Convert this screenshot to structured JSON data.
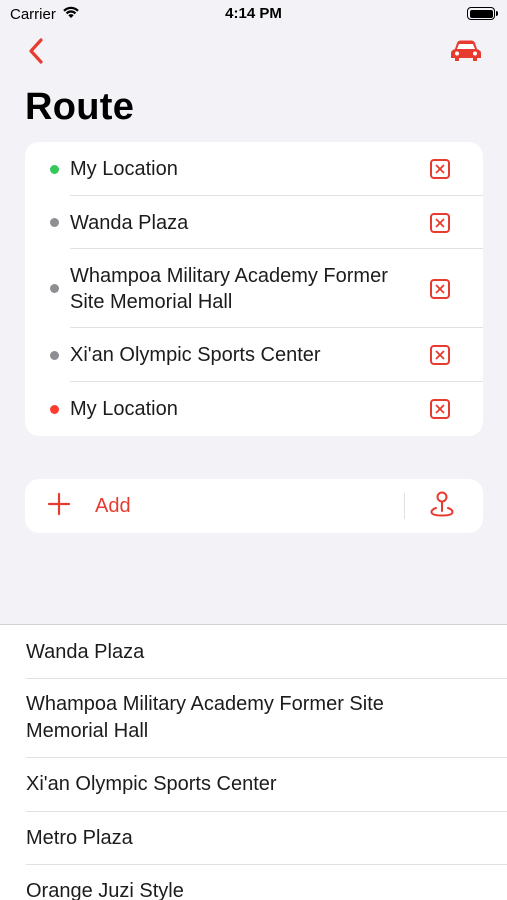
{
  "status_bar": {
    "carrier": "Carrier",
    "time": "4:14 PM"
  },
  "nav": {
    "back_icon": "chevron-left-icon",
    "car_icon": "car-icon",
    "title": "Route"
  },
  "colors": {
    "accent": "#e83b30",
    "start_dot": "#34c759",
    "mid_dot": "#8e8e93",
    "end_dot": "#ff3b30"
  },
  "route": {
    "stops": [
      {
        "label": "My Location",
        "dot": "start"
      },
      {
        "label": "Wanda Plaza",
        "dot": "mid"
      },
      {
        "label": "Whampoa Military Academy Former Site Memorial Hall",
        "dot": "mid"
      },
      {
        "label": "Xi'an Olympic Sports Center",
        "dot": "mid"
      },
      {
        "label": "My Location",
        "dot": "end"
      }
    ]
  },
  "add": {
    "label": "Add",
    "icon": "plus-icon",
    "pin_icon": "map-pin-icon"
  },
  "suggestions": [
    "Wanda Plaza",
    "Whampoa Military Academy Former Site Memorial Hall",
    "Xi'an Olympic Sports Center",
    "Metro Plaza",
    "Orange Juzi Style"
  ]
}
